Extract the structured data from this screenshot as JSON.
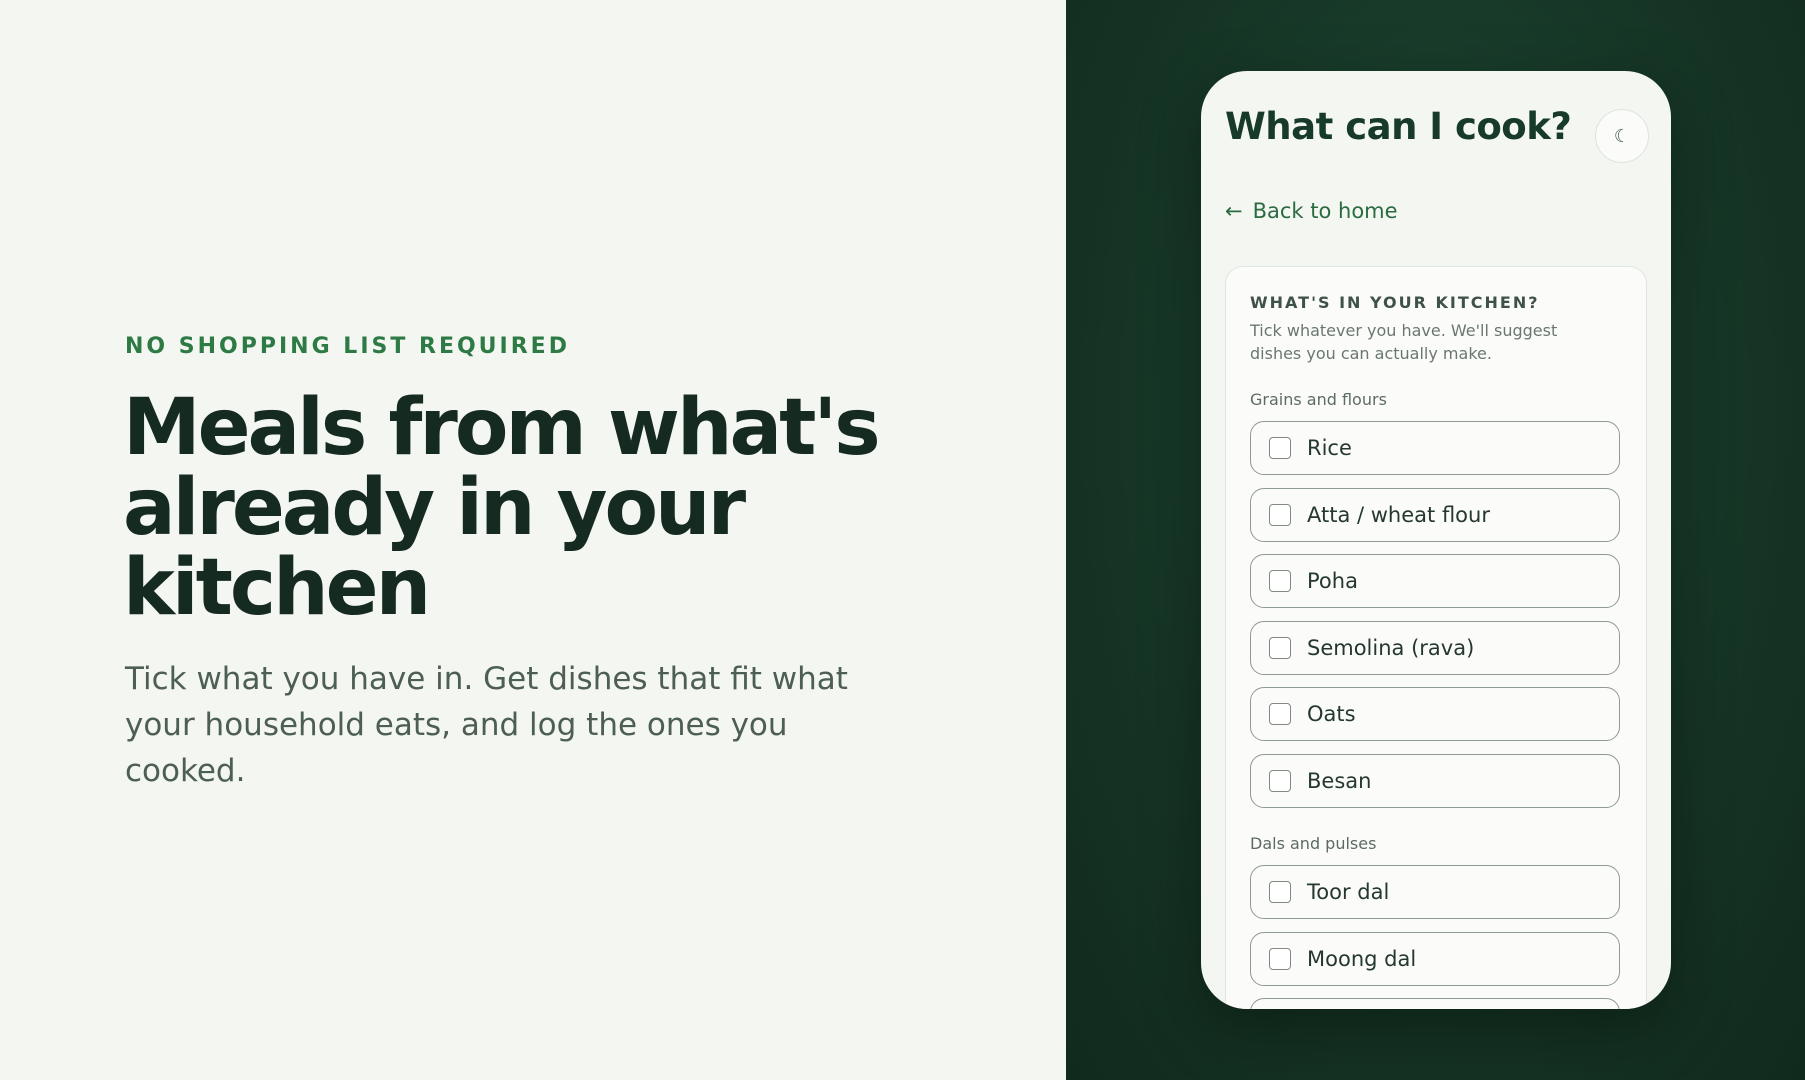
{
  "hero": {
    "eyebrow": "NO SHOPPING LIST REQUIRED",
    "headline": "Meals from what's already in your kitchen",
    "subtitle": "Tick what you have in. Get dishes that fit what your household eats, and log the ones you cooked."
  },
  "app": {
    "title": "What can I cook?",
    "theme_toggle_icon": "☾",
    "back_arrow": "←",
    "back_label": "Back to home",
    "card": {
      "heading": "WHAT'S IN YOUR KITCHEN?",
      "description": "Tick whatever you have. We'll suggest dishes you can actually make.",
      "groups": [
        {
          "label": "Grains and flours",
          "items": [
            {
              "label": "Rice",
              "checked": false
            },
            {
              "label": "Atta / wheat flour",
              "checked": false
            },
            {
              "label": "Poha",
              "checked": false
            },
            {
              "label": "Semolina (rava)",
              "checked": false
            },
            {
              "label": "Oats",
              "checked": false
            },
            {
              "label": "Besan",
              "checked": false
            }
          ]
        },
        {
          "label": "Dals and pulses",
          "items": [
            {
              "label": "Toor dal",
              "checked": false
            },
            {
              "label": "Moong dal",
              "checked": false
            }
          ]
        }
      ]
    }
  },
  "colors": {
    "accent_green": "#2e7a45",
    "dark_panel": "#163626",
    "light_bg": "#f3f6f1"
  }
}
